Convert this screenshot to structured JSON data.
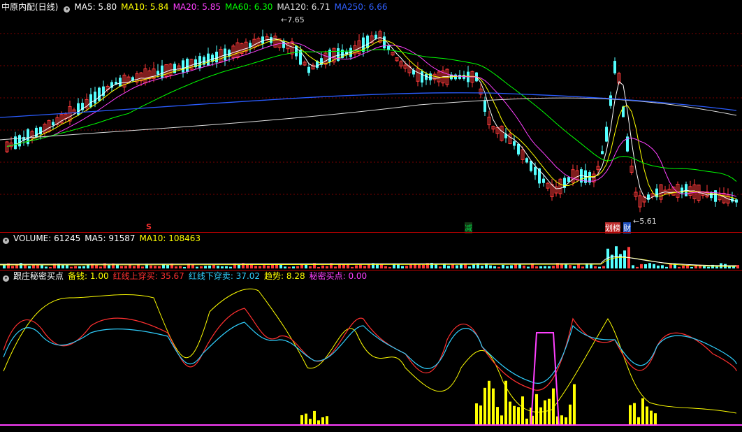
{
  "main": {
    "title": "中原内配(日线)",
    "ma": [
      {
        "label": "MA5: 5.80",
        "color": "#ffffff"
      },
      {
        "label": "MA10: 5.84",
        "color": "#ffff00"
      },
      {
        "label": "MA20: 5.85",
        "color": "#ff00ff"
      },
      {
        "label": "MA60: 6.30",
        "color": "#00ff00"
      },
      {
        "label": "MA120: 6.71",
        "color": "#dddddd"
      },
      {
        "label": "MA250: 6.66",
        "color": "#2a5cff"
      }
    ],
    "high_label": "7.65",
    "low_label": "5.61",
    "markers": {
      "s": "S",
      "jian": "减",
      "bang": "划榜",
      "cai": "财"
    }
  },
  "volume": {
    "vol_label": "VOLUME: 61245",
    "ma5_label": "MA5: 91587",
    "ma10_label": "MA10: 108463"
  },
  "indicator": {
    "title": "跟庄秘密买点",
    "items": [
      {
        "label": "备钱: 1.00",
        "color": "#ffff00"
      },
      {
        "label": "红线上穿买: 35.67",
        "color": "#ff3030"
      },
      {
        "label": "红线下穿卖: 37.02",
        "color": "#30d0ff"
      },
      {
        "label": "趋势: 8.28",
        "color": "#ffff00"
      },
      {
        "label": "秘密买点: 0.00",
        "color": "#ff40ff"
      }
    ]
  },
  "colors": {
    "up": "#ff3a3a",
    "down": "#54ffff",
    "grid": "#7a0000"
  }
}
